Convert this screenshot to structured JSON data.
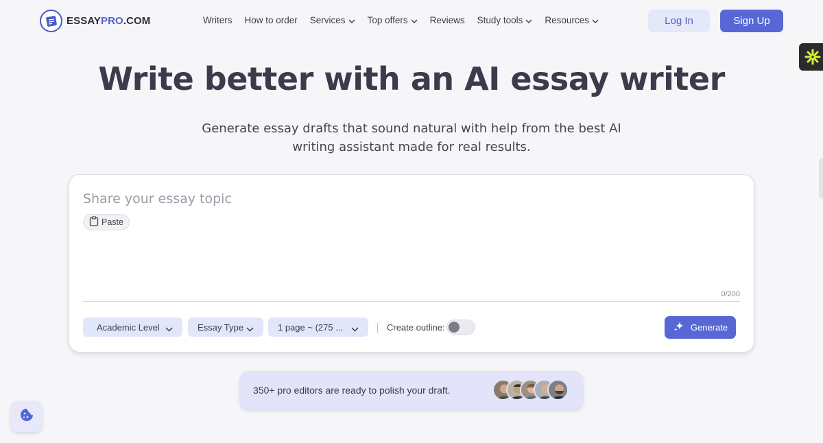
{
  "header": {
    "logo": {
      "part1": "ESSAY",
      "part2": "PRO",
      "part3": ".COM"
    },
    "nav": [
      {
        "label": "Writers",
        "dropdown": false
      },
      {
        "label": "How to order",
        "dropdown": false
      },
      {
        "label": "Services",
        "dropdown": true
      },
      {
        "label": "Top offers",
        "dropdown": true
      },
      {
        "label": "Reviews",
        "dropdown": false
      },
      {
        "label": "Study tools",
        "dropdown": true
      },
      {
        "label": "Resources",
        "dropdown": true
      }
    ],
    "login_label": "Log In",
    "signup_label": "Sign Up"
  },
  "hero": {
    "title": "Write better with an AI essay writer",
    "subtitle": "Generate essay drafts that sound natural with help from the best AI writing assistant made for real results."
  },
  "form": {
    "topic_placeholder": "Share your essay topic",
    "topic_value": "",
    "paste_label": "Paste",
    "counter": "0/200",
    "academic_level": "Academic Level",
    "essay_type": "Essay Type",
    "pages": "1 page ~ (275 ...",
    "outline_label": "Create outline:",
    "outline_enabled": false,
    "generate_label": "Generate"
  },
  "editors": {
    "text": "350+ pro editors are ready to polish your draft."
  },
  "icons": {
    "logo": "essay-logo-icon",
    "paste": "clipboard-icon",
    "generate": "sparkle-icon",
    "cookie": "cookie-icon",
    "side_badge": "asterisk-icon"
  },
  "colors": {
    "primary": "#5768d6",
    "login_bg": "#e4e8f9",
    "select_bg": "#e1e6f9",
    "banner_bg": "#e3e3fa",
    "page_bg": "#f6f6f9"
  }
}
